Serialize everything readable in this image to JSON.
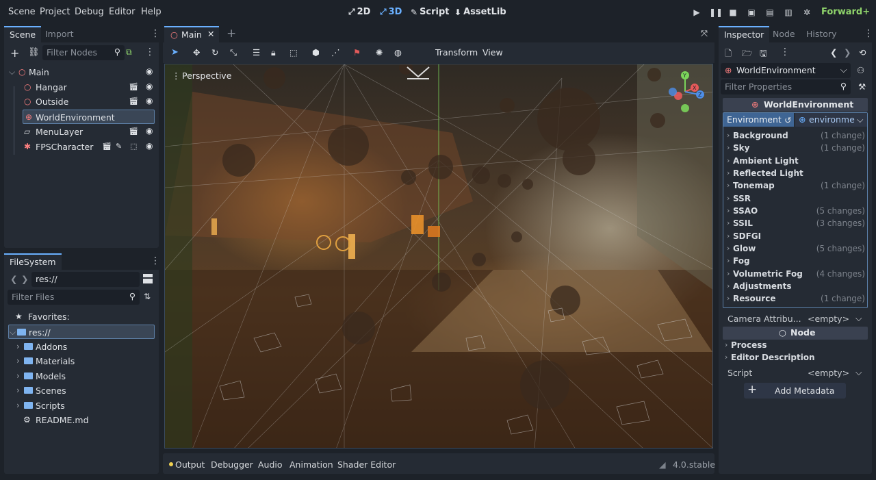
{
  "menu": [
    "Scene",
    "Project",
    "Debug",
    "Editor",
    "Help"
  ],
  "workspaces": {
    "w2d": "2D",
    "w3d": "3D",
    "script": "Script",
    "assetlib": "AssetLib"
  },
  "renderer": "Forward+",
  "scene_dock": {
    "tabs": [
      "Scene",
      "Import"
    ],
    "filter_placeholder": "Filter Nodes",
    "nodes": [
      {
        "label": "Main"
      },
      {
        "label": "Hangar"
      },
      {
        "label": "Outside"
      },
      {
        "label": "WorldEnvironment"
      },
      {
        "label": "MenuLayer"
      },
      {
        "label": "FPSCharacter"
      }
    ]
  },
  "filesystem": {
    "tab": "FileSystem",
    "path": "res://",
    "filter_placeholder": "Filter Files",
    "favorites": "Favorites:",
    "root": "res://",
    "items": [
      "Addons",
      "Materials",
      "Models",
      "Scenes",
      "Scripts",
      "README.md"
    ]
  },
  "editor_tab": {
    "label": "Main"
  },
  "toolbar": {
    "transform": "Transform",
    "view": "View"
  },
  "viewport": {
    "label": "Perspective"
  },
  "gizmo": {
    "y": "Y",
    "x": "X",
    "z": "Z"
  },
  "inspector": {
    "tabs": [
      "Inspector",
      "Node",
      "History"
    ],
    "object": "WorldEnvironment",
    "filter_placeholder": "Filter Properties",
    "header": "WorldEnvironment",
    "env_label": "Environment",
    "env_value": "environme",
    "sections": [
      {
        "name": "Background",
        "changes": "(1 change)"
      },
      {
        "name": "Sky",
        "changes": "(1 change)"
      },
      {
        "name": "Ambient Light",
        "changes": ""
      },
      {
        "name": "Reflected Light",
        "changes": ""
      },
      {
        "name": "Tonemap",
        "changes": "(1 change)"
      },
      {
        "name": "SSR",
        "changes": ""
      },
      {
        "name": "SSAO",
        "changes": "(5 changes)"
      },
      {
        "name": "SSIL",
        "changes": "(3 changes)"
      },
      {
        "name": "SDFGI",
        "changes": ""
      },
      {
        "name": "Glow",
        "changes": "(5 changes)"
      },
      {
        "name": "Fog",
        "changes": ""
      },
      {
        "name": "Volumetric Fog",
        "changes": "(4 changes)"
      },
      {
        "name": "Adjustments",
        "changes": ""
      },
      {
        "name": "Resource",
        "changes": "(1 change)"
      }
    ],
    "camera_attr_label": "Camera Attribu...",
    "camera_attr_value": "<empty>",
    "node_header": "Node",
    "process": "Process",
    "editor_description": "Editor Description",
    "script_label": "Script",
    "script_value": "<empty>",
    "add_metadata": "Add Metadata"
  },
  "bottom_panel": {
    "items": [
      "Output",
      "Debugger",
      "Audio",
      "Animation",
      "Shader Editor"
    ],
    "version": "4.0.stable"
  },
  "colors": {
    "accent": "#6ab0ff",
    "renderer": "#8fd46b",
    "selection": "#3a4656"
  }
}
